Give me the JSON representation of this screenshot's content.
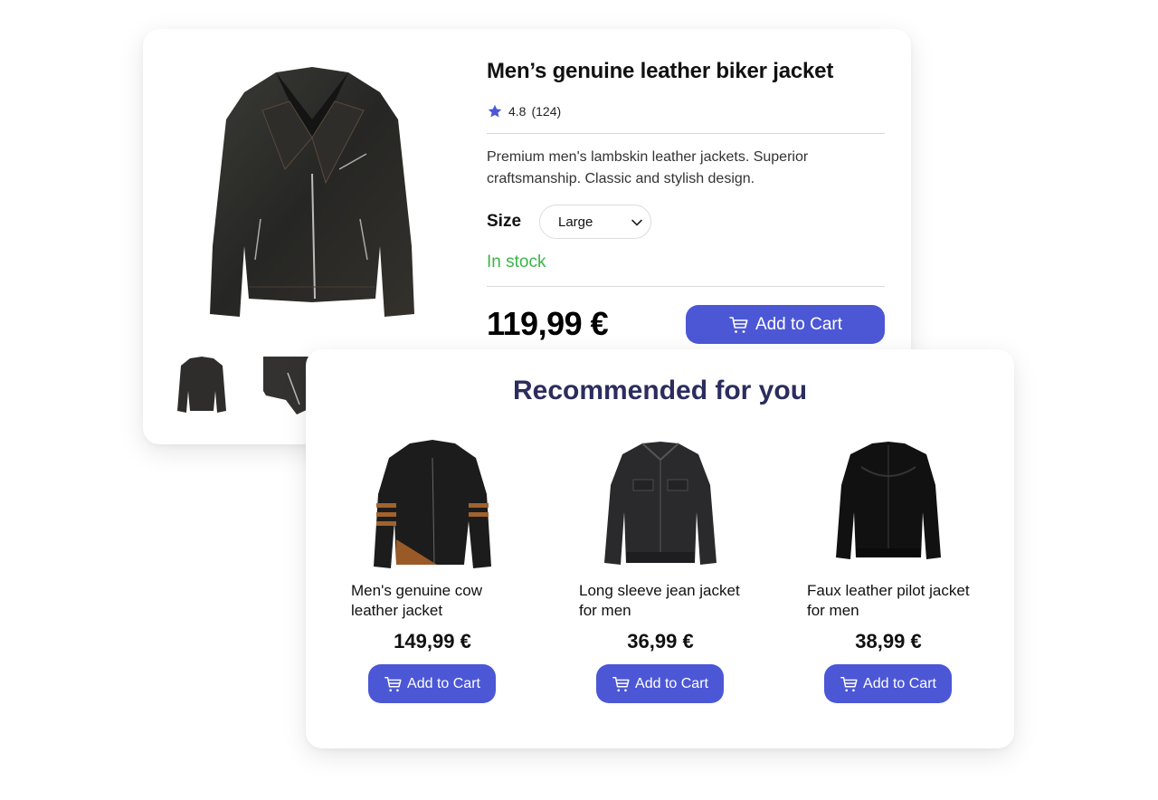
{
  "product": {
    "title": "Men’s genuine leather biker jacket",
    "rating": "4.8",
    "review_count": "(124)",
    "description": "Premium men's lambskin leather jackets. Superior craftsmanship. Classic and stylish design.",
    "size_label": "Size",
    "size_selected": "Large",
    "stock_status": "In stock",
    "price": "119,99 €",
    "add_to_cart_label": "Add to Cart",
    "images": [
      "front-view",
      "back-view",
      "sleeve-detail"
    ]
  },
  "recommendations": {
    "title": "Recommended for you",
    "items": [
      {
        "name": "Men's genuine cow leather jacket",
        "price": "149,99 €",
        "button_label": "Add to Cart"
      },
      {
        "name": "Long sleeve jean jacket for men",
        "price": "36,99 €",
        "button_label": "Add to Cart"
      },
      {
        "name": "Faux leather pilot jacket for men",
        "price": "38,99 €",
        "button_label": "Add to Cart"
      }
    ]
  },
  "colors": {
    "accent": "#4c57d6",
    "stock_green": "#3cb54a",
    "heading_navy": "#2b2d5e",
    "star": "#4c57d6"
  }
}
